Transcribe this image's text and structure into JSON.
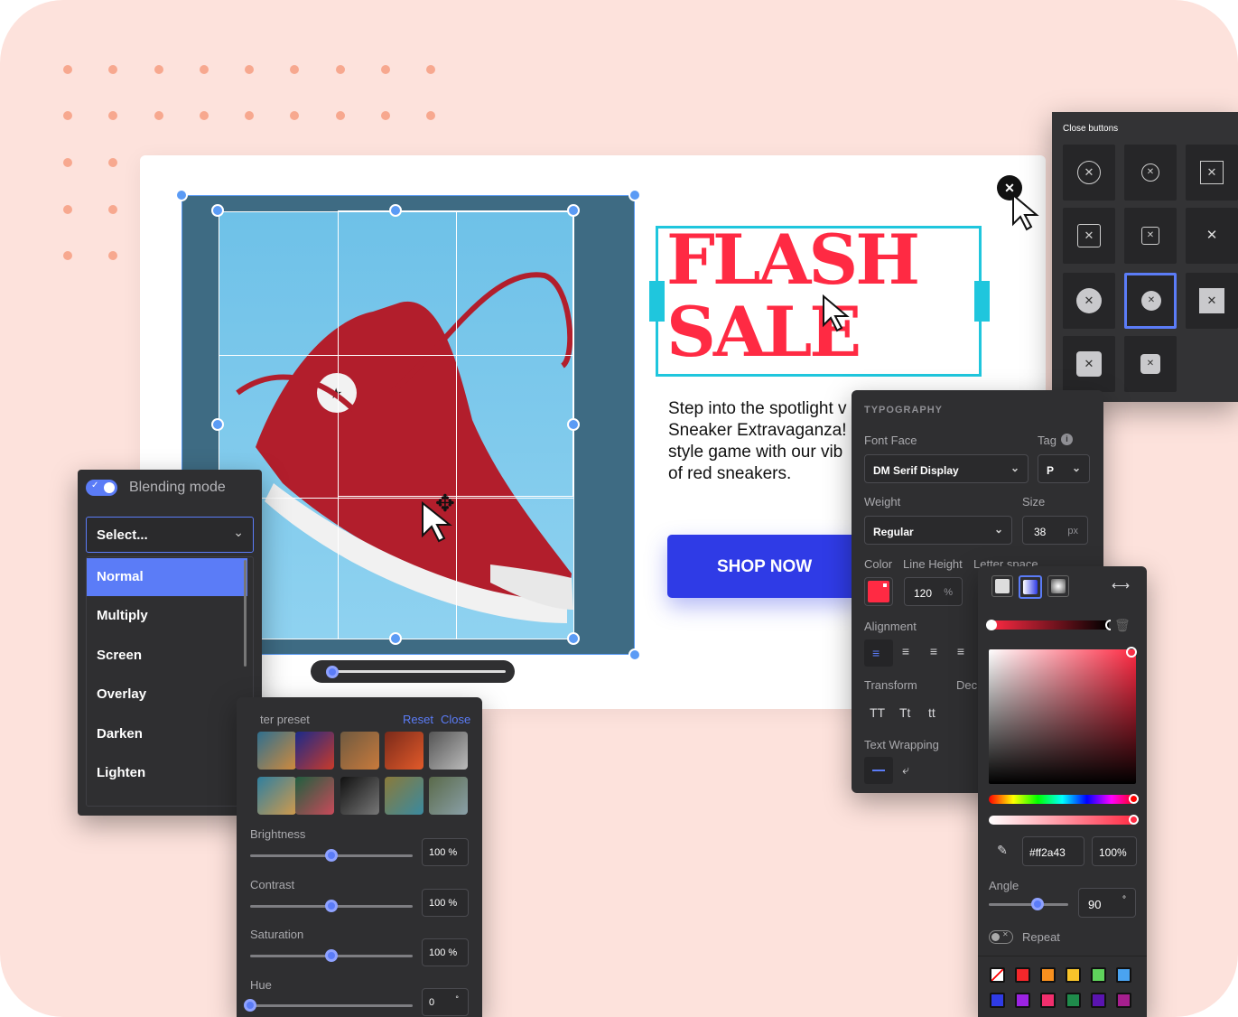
{
  "headline": {
    "line1": "FLASH",
    "line2": "SALE",
    "color": "#ff2a43"
  },
  "body_text": {
    "l1": "Step into the spotlight v",
    "l2": "Sneaker Extravaganza!",
    "l3": "style game with our vib",
    "l4": "of red sneakers."
  },
  "cta": {
    "label": "SHOP NOW",
    "color": "#2f3be6"
  },
  "blending": {
    "title": "Blending mode",
    "select_placeholder": "Select...",
    "options": [
      "Normal",
      "Multiply",
      "Screen",
      "Overlay",
      "Darken",
      "Lighten"
    ],
    "selected": "Normal",
    "accent": "#5b7cf7"
  },
  "close_buttons": {
    "title": "Close buttons"
  },
  "filter": {
    "title": "ter preset",
    "reset": "Reset",
    "close": "Close",
    "brightness": {
      "label": "Brightness",
      "value": "100 %",
      "level": 0.5
    },
    "contrast": {
      "label": "Contrast",
      "value": "100 %",
      "level": 0.5
    },
    "saturation": {
      "label": "Saturation",
      "value": "100 %",
      "level": 0.5
    },
    "hue": {
      "label": "Hue",
      "value": "0",
      "unit": "°",
      "level": 0.0
    }
  },
  "typography": {
    "title": "TYPOGRAPHY",
    "font_face_label": "Font Face",
    "font_face": "DM Serif Display",
    "tag_label": "Tag",
    "tag": "P",
    "weight_label": "Weight",
    "weight": "Regular",
    "size_label": "Size",
    "size": "38",
    "size_unit": "px",
    "color_label": "Color",
    "line_height_label": "Line Height",
    "line_height": "120",
    "lh_unit": "%",
    "letter_space_label": "Letter space",
    "alignment_label": "Alignment",
    "transform_label": "Transform",
    "decoration_label": "Dec",
    "transform_opts": [
      "TT",
      "Tt",
      "tt"
    ],
    "wrap_label": "Text Wrapping"
  },
  "color_picker": {
    "hex": "#ff2a43",
    "alpha": "100%",
    "angle_label": "Angle",
    "angle": "90",
    "angle_unit": "°",
    "repeat_label": "Repeat",
    "swatches_row1": [
      "#ff0000",
      "#f4272b",
      "#f7901e",
      "#f8c42a",
      "#5fd35c",
      "#4aa3f0"
    ],
    "swatches_row2": [
      "#2f3be6",
      "#9b23e2",
      "#f12f6d",
      "#1f8b4b",
      "#5a14b0",
      "#a61f8e"
    ]
  },
  "crop": {
    "zoom_level": 0.03
  }
}
